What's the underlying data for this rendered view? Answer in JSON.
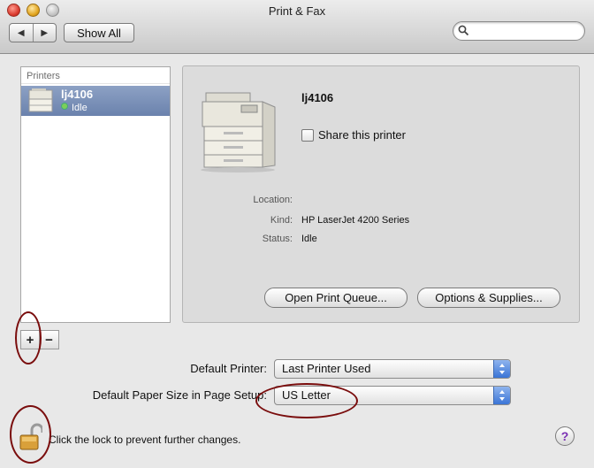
{
  "window": {
    "title": "Print & Fax",
    "traffic_colors": [
      "#e24a3b",
      "#e3a827",
      "#bdbdbd"
    ]
  },
  "toolbar": {
    "back_icon": "back-arrow-icon",
    "forward_icon": "forward-arrow-icon",
    "show_all_label": "Show All",
    "search_placeholder": "",
    "search_value": ""
  },
  "printers_list": {
    "header": "Printers",
    "items": [
      {
        "name": "lj4106",
        "status": "Idle",
        "status_color": "#7bcf5a",
        "selected": true
      }
    ],
    "add_label": "+",
    "remove_label": "−"
  },
  "detail": {
    "printer_name": "lj4106",
    "share_label": "Share this printer",
    "share_checked": false,
    "fields": [
      {
        "label": "Location:",
        "value": ""
      },
      {
        "label": "Kind:",
        "value": "HP LaserJet 4200 Series"
      },
      {
        "label": "Status:",
        "value": "Idle"
      }
    ],
    "open_queue_label": "Open Print Queue...",
    "options_label": "Options & Supplies..."
  },
  "defaults": {
    "printer_label": "Default Printer:",
    "printer_value": "Last Printer Used",
    "paper_label": "Default Paper Size in Page Setup:",
    "paper_value": "US Letter"
  },
  "footer": {
    "lock_text": "Click the lock to prevent further changes.",
    "help_label": "?"
  },
  "colors": {
    "selection": "#7a90ba",
    "popup_accent": "#3a74d6",
    "annotation": "#7a0d0d"
  }
}
